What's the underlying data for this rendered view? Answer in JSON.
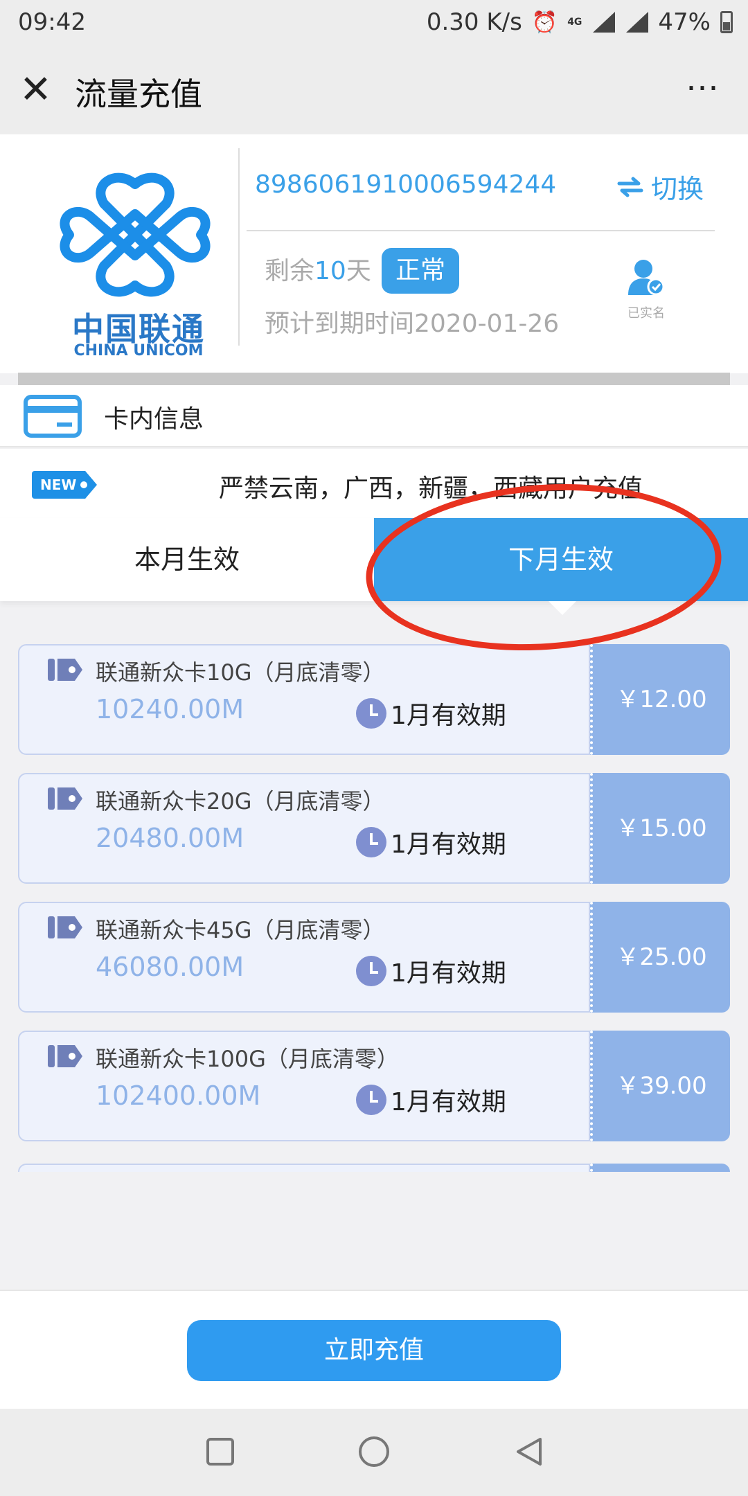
{
  "status_bar": {
    "time": "09:42",
    "net_speed": "0.30 K/s",
    "alarm_icon": "⏰",
    "network_icon": "4G",
    "battery": "47%"
  },
  "titlebar": {
    "close_icon": "✕",
    "title": "流量充值",
    "more_icon": "⋯"
  },
  "card": {
    "logo_cn": "中国联通",
    "logo_en": "CHINA UNICOM",
    "iccid": "8986061910006594244",
    "switch_label": "切换",
    "remaining_prefix": "剩余",
    "remaining_days": "10",
    "remaining_suffix": "天",
    "status": "正常",
    "expire_text": "预计到期时间2020-01-26",
    "verified_label": "已实名"
  },
  "card_info_label": "卡内信息",
  "notice": {
    "badge": "NEW",
    "text": "严禁云南，广西，新疆，西藏用户充值"
  },
  "tabs": {
    "this_month": "本月生效",
    "next_month": "下月生效"
  },
  "packages": [
    {
      "name": "联通新众卡10G（月底清零）",
      "size": "10240.00M",
      "validity": "1月有效期",
      "price": "￥12.00"
    },
    {
      "name": "联通新众卡20G（月底清零）",
      "size": "20480.00M",
      "validity": "1月有效期",
      "price": "￥15.00"
    },
    {
      "name": "联通新众卡45G（月底清零）",
      "size": "46080.00M",
      "validity": "1月有效期",
      "price": "￥25.00"
    },
    {
      "name": "联通新众卡100G（月底清零）",
      "size": "102400.00M",
      "validity": "1月有效期",
      "price": "￥39.00"
    }
  ],
  "action": {
    "recharge_label": "立即充值"
  },
  "colors": {
    "accent": "#3aa0e8",
    "price_bg": "#8fb3e8",
    "annotation": "#e8321f"
  }
}
